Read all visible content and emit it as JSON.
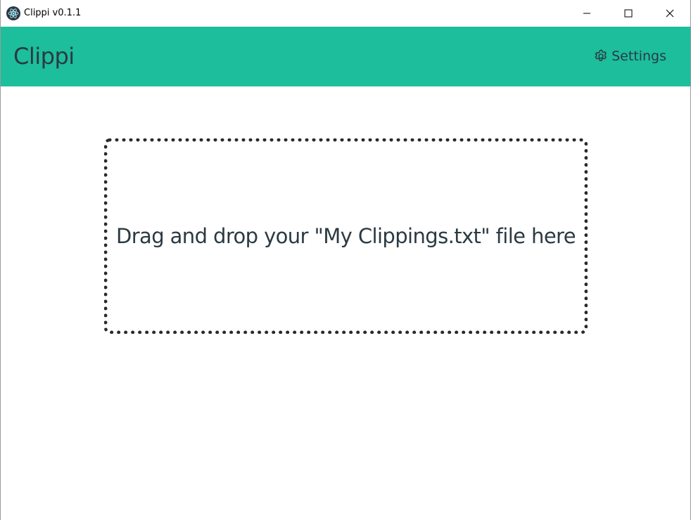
{
  "window": {
    "title": "Clippi v0.1.1",
    "app_icon": "electron-atom-icon",
    "controls": {
      "minimize": "minimize-icon",
      "maximize": "maximize-icon",
      "close": "close-icon"
    }
  },
  "header": {
    "app_name": "Clippi",
    "settings_label": "Settings",
    "settings_icon": "gear-icon",
    "background_color": "#1dbe9c",
    "text_color": "#2b3a42"
  },
  "main": {
    "dropzone_text": "Drag and drop your \"My Clippings.txt\" file here"
  }
}
